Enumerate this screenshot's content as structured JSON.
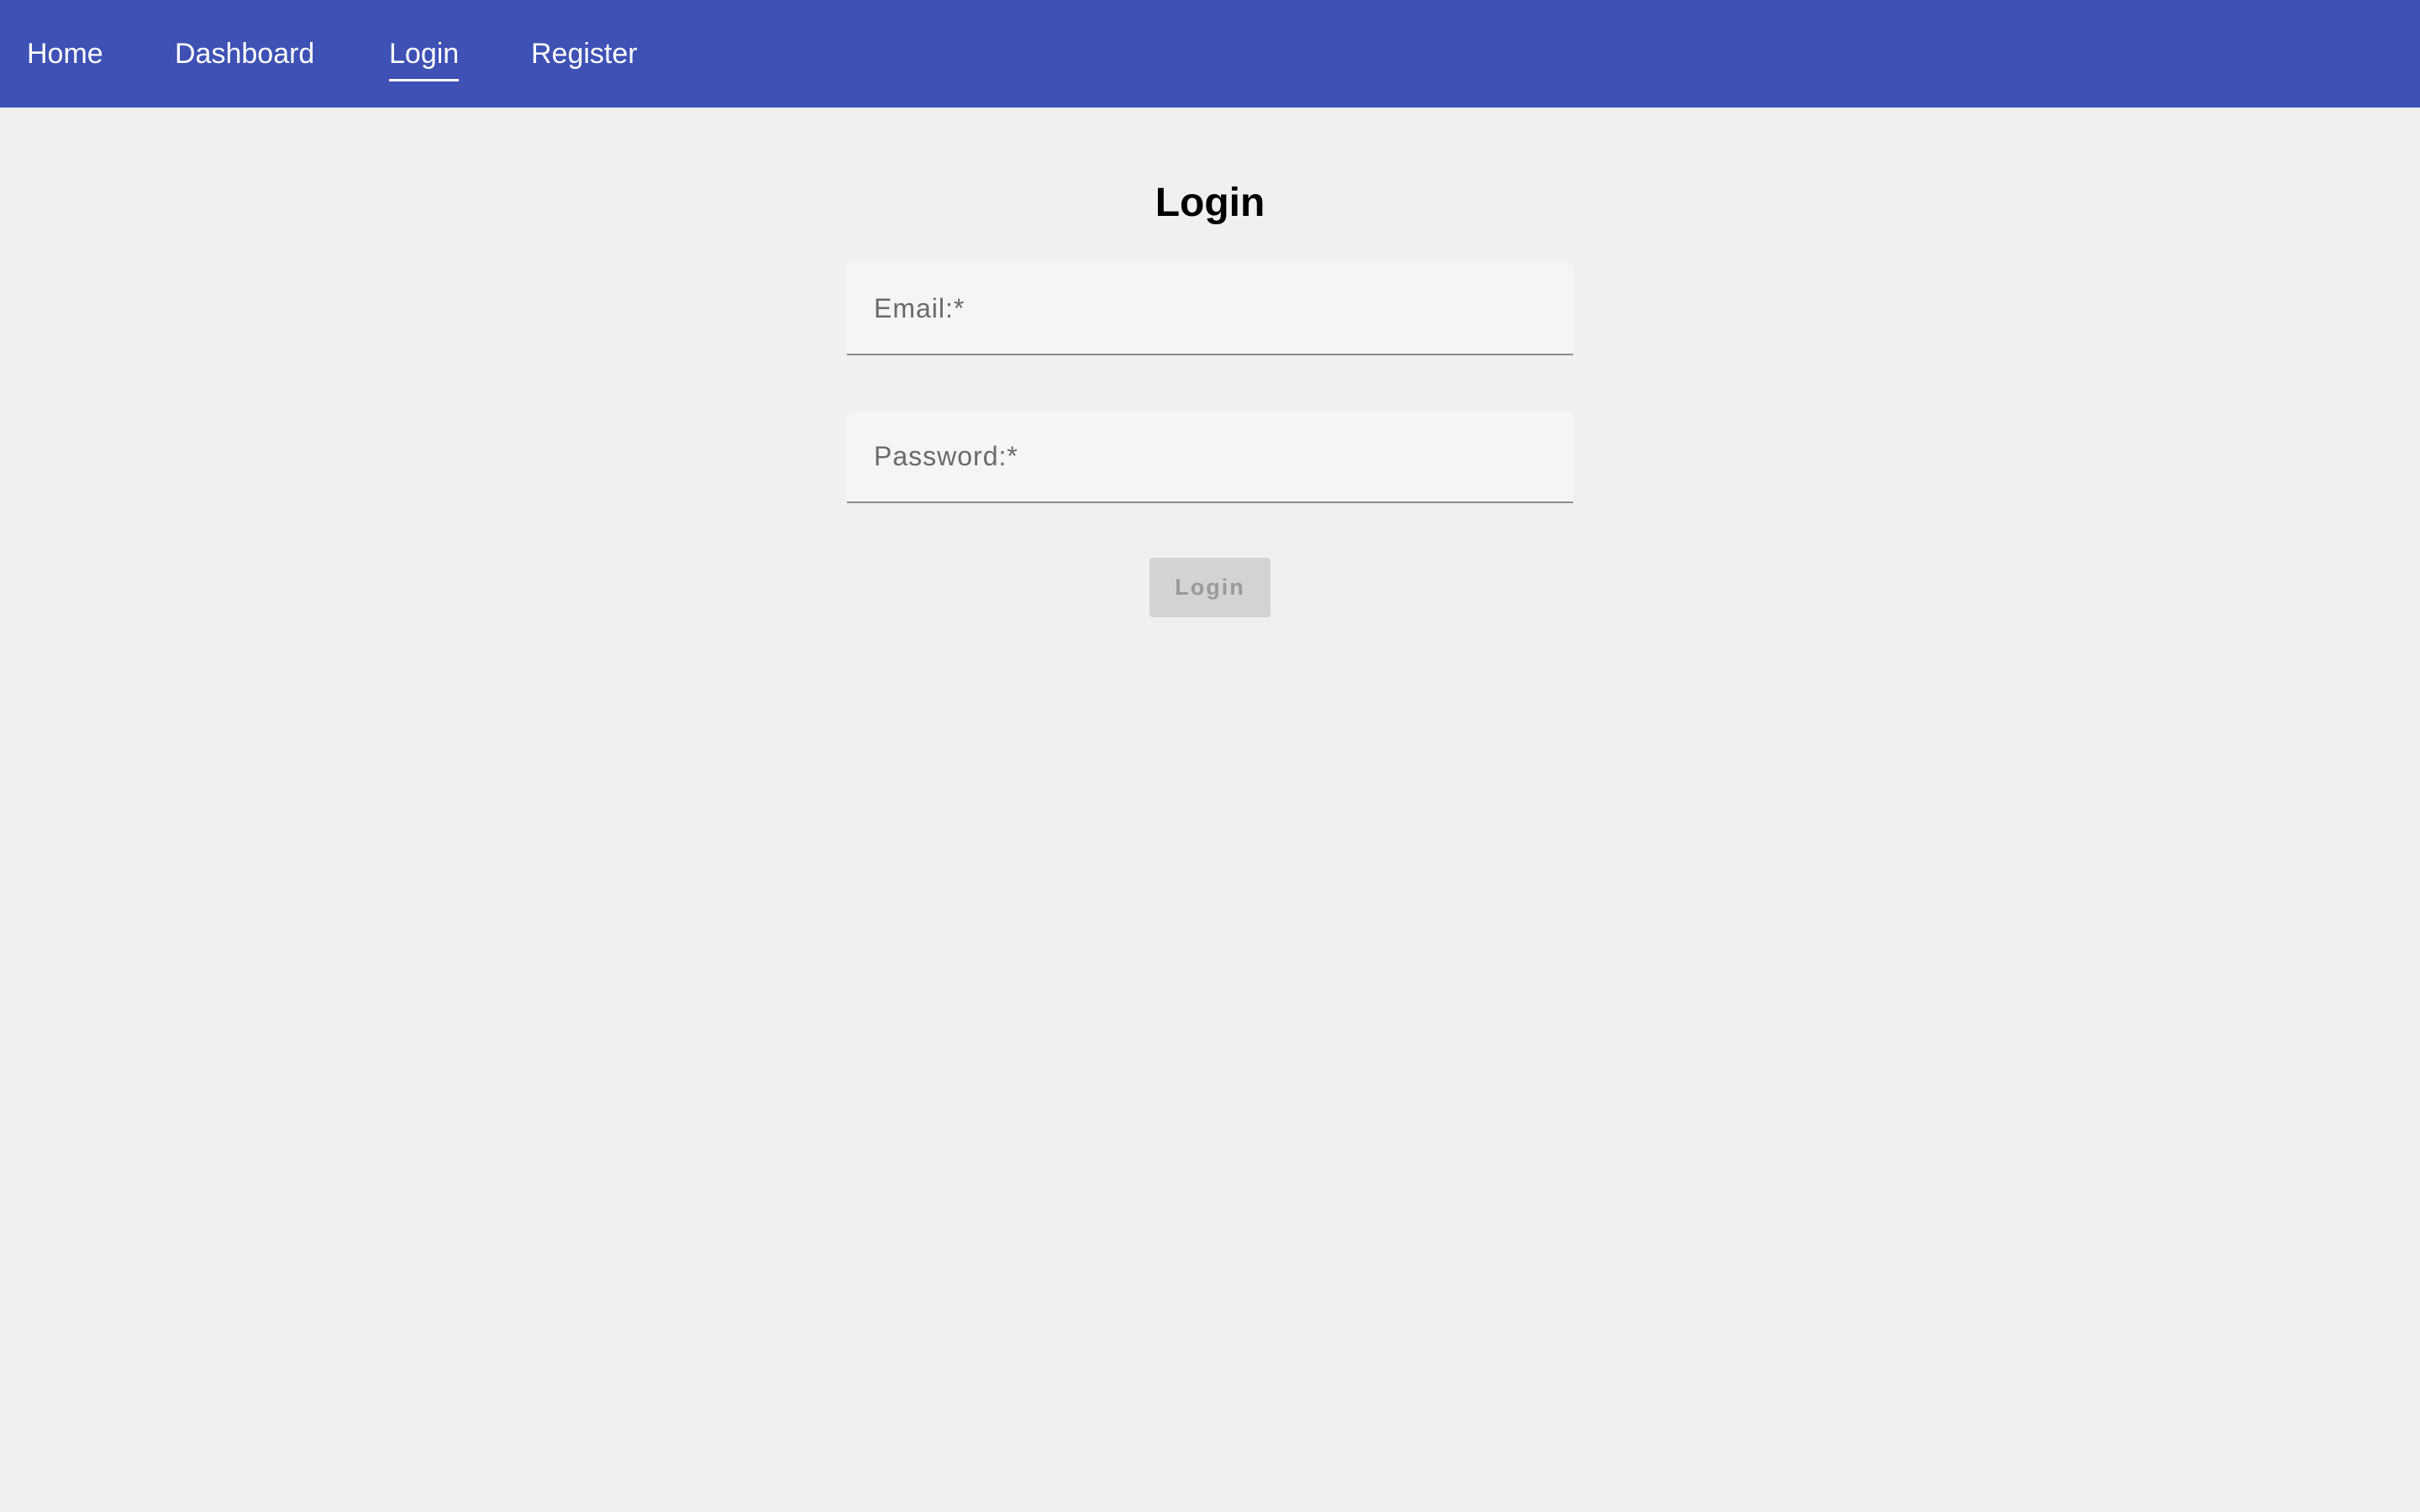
{
  "nav": {
    "items": [
      {
        "label": "Home",
        "active": false
      },
      {
        "label": "Dashboard",
        "active": false
      },
      {
        "label": "Login",
        "active": true
      },
      {
        "label": "Register",
        "active": false
      }
    ]
  },
  "main": {
    "title": "Login",
    "email": {
      "placeholder": "Email:*",
      "value": ""
    },
    "password": {
      "placeholder": "Password:*",
      "value": ""
    },
    "submit_label": "Login",
    "submit_disabled": true
  },
  "colors": {
    "navbar": "#3f51b5",
    "background": "#f0f0f0",
    "field": "#f5f5f5",
    "button_disabled": "#d3d3d3"
  }
}
